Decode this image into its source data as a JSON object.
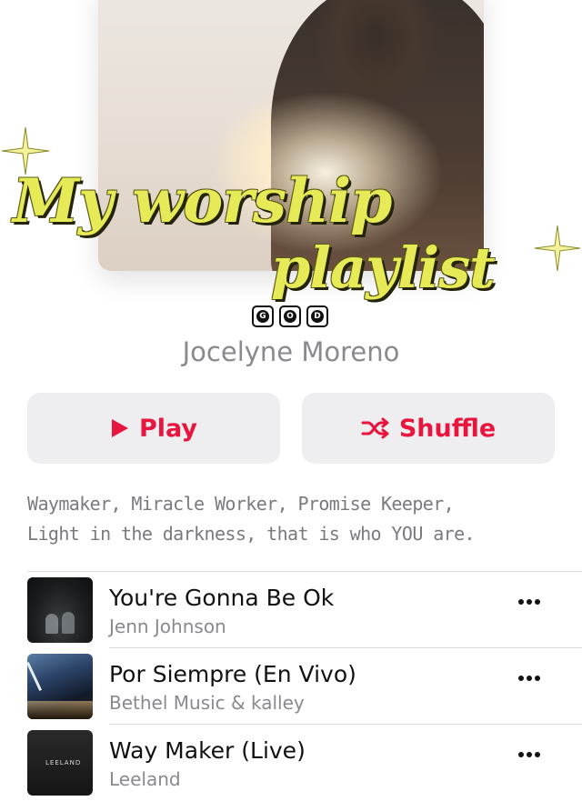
{
  "playlist": {
    "overlay_title_line1": "My worship",
    "overlay_title_line2": "playlist",
    "badge_letters": [
      "G",
      "O",
      "D"
    ],
    "curator": "Jocelyne Moreno"
  },
  "actions": {
    "play_label": "Play",
    "shuffle_label": "Shuffle",
    "accent_color": "#e8163f"
  },
  "description": {
    "line1": "Waymaker, Miracle Worker, Promise Keeper,",
    "line2": "Light in the darkness, that is who YOU are."
  },
  "songs": [
    {
      "title": "You're Gonna Be Ok",
      "artist": "Jenn Johnson"
    },
    {
      "title": "Por Siempre (En Vivo)",
      "artist": "Bethel Music & kalley"
    },
    {
      "title": "Way Maker (Live)",
      "artist": "Leeland",
      "art_text": "LEELAND"
    }
  ],
  "icons": {
    "play": "play-icon",
    "shuffle": "shuffle-icon",
    "more": "more-icon",
    "sparkle": "sparkle-icon"
  }
}
